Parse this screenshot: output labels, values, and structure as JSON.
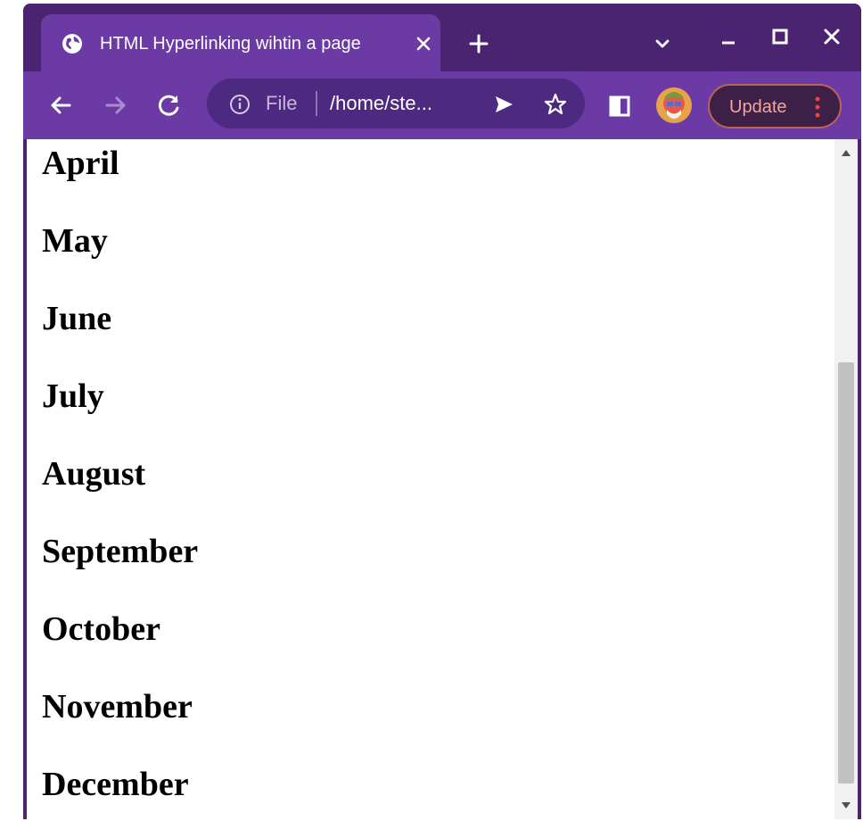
{
  "browser": {
    "tab": {
      "title": "HTML Hyperlinking wihtin a page",
      "favicon": "globe-icon",
      "close_icon": "close-icon"
    },
    "new_tab_icon": "plus-icon",
    "tab_search_icon": "chevron-down-icon",
    "window_controls": [
      "minimize-icon",
      "maximize-icon",
      "close-icon"
    ],
    "toolbar": {
      "back_icon": "arrow-left-icon",
      "forward_icon": "arrow-right-icon",
      "reload_icon": "reload-icon",
      "site_info_icon": "info-icon",
      "scheme_label": "File",
      "url": "/home/ste...",
      "send_icon": "send-icon",
      "bookmark_icon": "star-icon",
      "side_panel_icon": "side-panel-icon",
      "avatar": "avatar",
      "update_label": "Update",
      "menu_icon": "kebab-menu-icon"
    },
    "colors": {
      "frame": "#4a2470",
      "toolbar": "#6b3aa5",
      "omnibox": "#4d2a80",
      "update_border": "#b96655",
      "update_text": "#f0a798"
    }
  },
  "page": {
    "months": [
      "April",
      "May",
      "June",
      "July",
      "August",
      "September",
      "October",
      "November",
      "December"
    ]
  }
}
